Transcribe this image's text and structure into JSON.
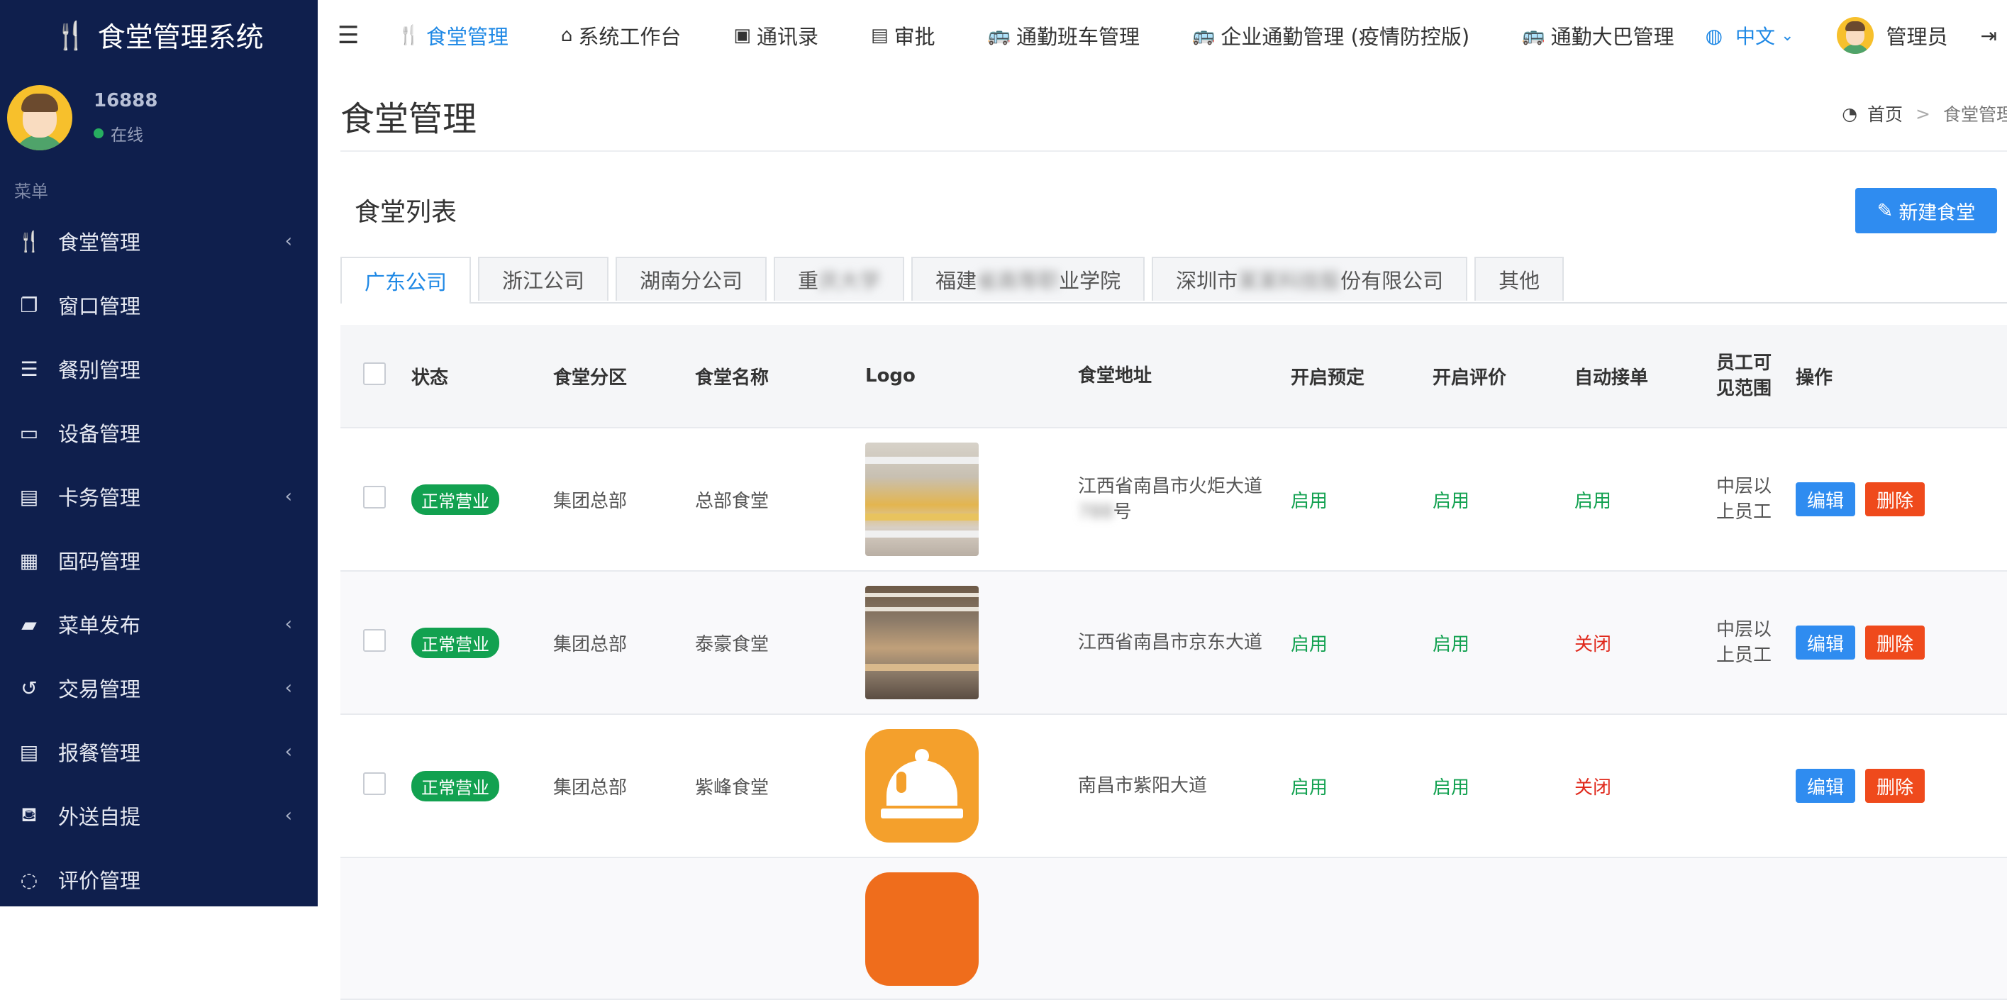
{
  "sidebar": {
    "brand": "食堂管理系统",
    "user": {
      "name": "16888",
      "status": "在线"
    },
    "menu_header": "菜单",
    "items": [
      {
        "label": "食堂管理",
        "icon": "utensils-icon",
        "has_children": true
      },
      {
        "label": "窗口管理",
        "icon": "windows-icon",
        "has_children": false
      },
      {
        "label": "餐别管理",
        "icon": "list-icon",
        "has_children": false
      },
      {
        "label": "设备管理",
        "icon": "monitor-icon",
        "has_children": false
      },
      {
        "label": "卡务管理",
        "icon": "id-card-icon",
        "has_children": true
      },
      {
        "label": "固码管理",
        "icon": "qrcode-icon",
        "has_children": false
      },
      {
        "label": "菜单发布",
        "icon": "book-icon",
        "has_children": true
      },
      {
        "label": "交易管理",
        "icon": "history-icon",
        "has_children": true
      },
      {
        "label": "报餐管理",
        "icon": "list-alt-icon",
        "has_children": true
      },
      {
        "label": "外送自提",
        "icon": "basket-icon",
        "has_children": true
      },
      {
        "label": "评价管理",
        "icon": "comment-icon",
        "has_children": false
      }
    ]
  },
  "topbar": {
    "nav": [
      {
        "label": "食堂管理",
        "icon": "utensils-icon",
        "active": true
      },
      {
        "label": "系统工作台",
        "icon": "home-icon",
        "active": false
      },
      {
        "label": "通讯录",
        "icon": "address-card-icon",
        "active": false
      },
      {
        "label": "审批",
        "icon": "file-icon",
        "active": false
      },
      {
        "label": "通勤班车管理",
        "icon": "bus-icon",
        "active": false
      },
      {
        "label": "企业通勤管理 (疫情防控版)",
        "icon": "bus-icon",
        "active": false
      },
      {
        "label": "通勤大巴管理",
        "icon": "bus-icon",
        "active": false
      }
    ],
    "language": "中文",
    "admin": "管理员"
  },
  "page": {
    "title": "食堂管理",
    "breadcrumb": [
      "首页",
      "食堂管理"
    ],
    "section_title": "食堂列表",
    "new_button": "新建食堂"
  },
  "tabs": [
    {
      "label": "广东公司",
      "active": true
    },
    {
      "label": "浙江公司",
      "active": false
    },
    {
      "label": "湖南分公司",
      "active": false
    },
    {
      "prefix": "重",
      "masked": "庆大学",
      "suffix": ""
    },
    {
      "prefix": "福建",
      "masked": "省高等职",
      "suffix": "业学院"
    },
    {
      "prefix": "深圳市",
      "masked": "某某科技股",
      "suffix": "份有限公司"
    },
    {
      "label": "其他",
      "active": false
    }
  ],
  "table": {
    "headers": {
      "status": "状态",
      "zone": "食堂分区",
      "name": "食堂名称",
      "logo": "Logo",
      "address": "食堂地址",
      "booking": "开启预定",
      "rating": "开启评价",
      "auto_accept": "自动接单",
      "scope": "员工可见范围",
      "ops": "操作"
    },
    "rows": [
      {
        "status": "正常营业",
        "zone": "集团总部",
        "name": "总部食堂",
        "address_line1": "江西省南昌市火炬大道",
        "address_masked": "788",
        "address_suffix": "号",
        "booking": "启用",
        "rating": "启用",
        "auto_accept": "启用",
        "scope": "中层以上员工"
      },
      {
        "status": "正常营业",
        "zone": "集团总部",
        "name": "泰豪食堂",
        "address_line1": "江西省南昌市京东大道",
        "booking": "启用",
        "rating": "启用",
        "auto_accept": "关闭",
        "scope": "中层以上员工"
      },
      {
        "status": "正常营业",
        "zone": "集团总部",
        "name": "紫峰食堂",
        "address_line1": "南昌市紫阳大道",
        "booking": "启用",
        "rating": "启用",
        "auto_accept": "关闭",
        "scope": ""
      }
    ],
    "edit_label": "编辑",
    "delete_label": "删除"
  },
  "colors": {
    "sidebar_bg": "#0f1f4d",
    "accent": "#1e88e5",
    "enabled": "#12a150",
    "disabled": "#e0291c",
    "delete_btn": "#ef4a1c"
  }
}
